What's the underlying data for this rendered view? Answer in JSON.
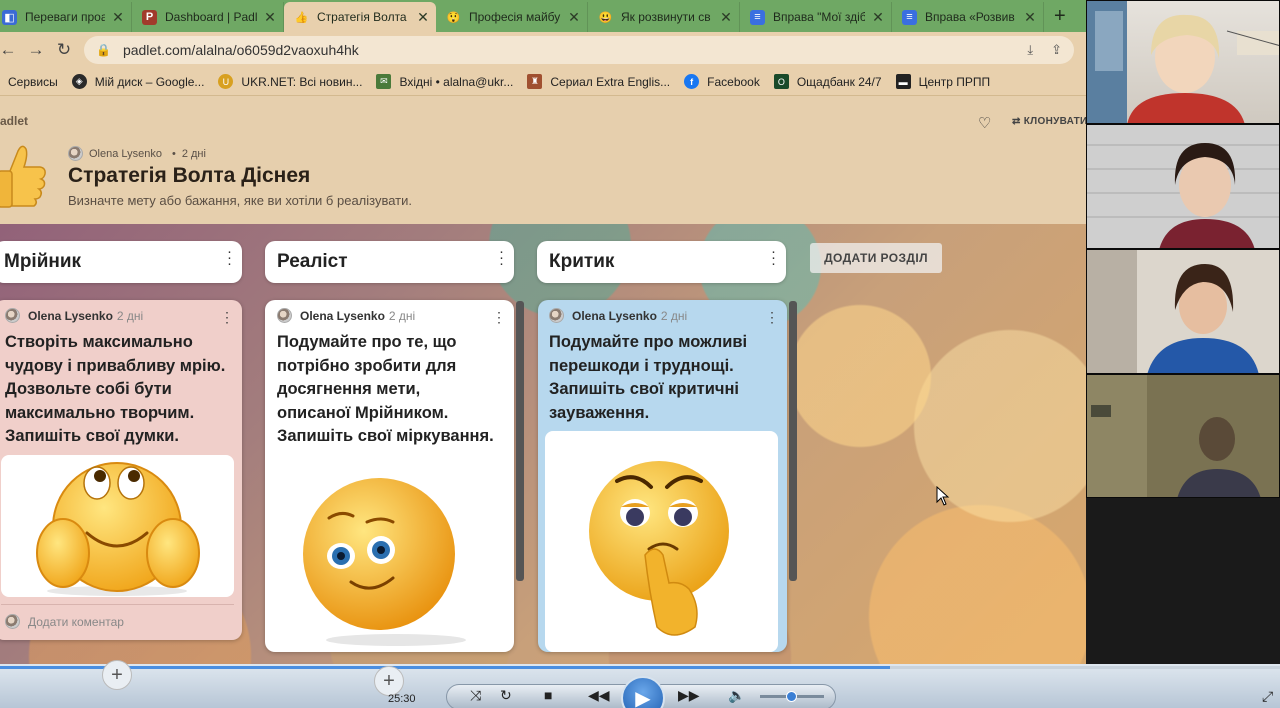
{
  "browser": {
    "tabs": [
      {
        "title": "Переваги проак",
        "color": "#3b6bd6",
        "glyph": "◧"
      },
      {
        "title": "Dashboard | Padl",
        "color": "#a13b2b",
        "glyph": "P"
      },
      {
        "title": "Стратегія Волта Д",
        "color": "#e8b54a",
        "glyph": "👍"
      },
      {
        "title": "Професія майбу",
        "color": "#f0c030",
        "glyph": "😲"
      },
      {
        "title": "Як розвинути св",
        "color": "#f0c030",
        "glyph": "😃"
      },
      {
        "title": "Вправа \"Мої здіб",
        "color": "#3a6fe0",
        "glyph": "≡"
      },
      {
        "title": "Вправа «Розвив",
        "color": "#3a6fe0",
        "glyph": "≡"
      }
    ],
    "url": "padlet.com/alalna/o6059d2vaoxuh4hk",
    "bookmarks": [
      {
        "label": "Сервисы",
        "color": "#6a6a6a",
        "glyph": "▦"
      },
      {
        "label": "Мій диск – Google...",
        "color": "#2a2a2a",
        "glyph": "◈"
      },
      {
        "label": "UKR.NET: Всі новин...",
        "color": "#d8a020",
        "glyph": "U"
      },
      {
        "label": "Вхідні • alalna@ukr...",
        "color": "#4a7a3a",
        "glyph": "✉"
      },
      {
        "label": "Сериал Extra Englis...",
        "color": "#a05030",
        "glyph": "♜"
      },
      {
        "label": "Facebook",
        "color": "#1877f2",
        "glyph": "f"
      },
      {
        "label": "Ощадбанк 24/7",
        "color": "#1a4a2a",
        "glyph": "O"
      },
      {
        "label": "Центр ПРПП",
        "color": "#222222",
        "glyph": "▬"
      }
    ]
  },
  "padlet": {
    "brand": "adlet",
    "remake_label": "КЛОНУВАТИ",
    "author": "Olena Lysenko",
    "age": "2 дні",
    "title": "Стратегія Волта Діснея",
    "description": "Визначте мету або бажання, яке ви хотіли б реалізувати.",
    "add_section": "ДОДАТИ РОЗДІЛ",
    "columns": [
      {
        "title": "Мрійник"
      },
      {
        "title": "Реаліст"
      },
      {
        "title": "Критик"
      }
    ],
    "posts": [
      {
        "author": "Olena Lysenko",
        "age": "2 дні",
        "lines": [
          "Створіть максимально",
          "чудову і привабливу мрію.",
          "Дозвольте собі бути",
          "максимально творчим.",
          "Запишіть свої думки."
        ],
        "comment": "Додати коментар",
        "bg": "#f0cfca"
      },
      {
        "author": "Olena Lysenko",
        "age": "2 дні",
        "lines": [
          "Подумайте про те, що",
          "потрібно зробити для",
          "досягнення мети,",
          "описаної Мрійником.",
          "Запишіть свої міркування."
        ],
        "bg": "#ffffff"
      },
      {
        "author": "Olena Lysenko",
        "age": "2 дні",
        "lines": [
          "Подумайте про можливі",
          "перешкоди і труднощі.",
          "Запишіть свої критичні",
          "зауваження."
        ],
        "bg": "#b7d8ee"
      }
    ]
  },
  "player": {
    "time": "25:30",
    "progress": 0.695,
    "volume": 0.5
  },
  "colors": {
    "tabbar": "#6fa864",
    "chrome": "#e8d0ad",
    "accent": "#4a8ee0"
  }
}
